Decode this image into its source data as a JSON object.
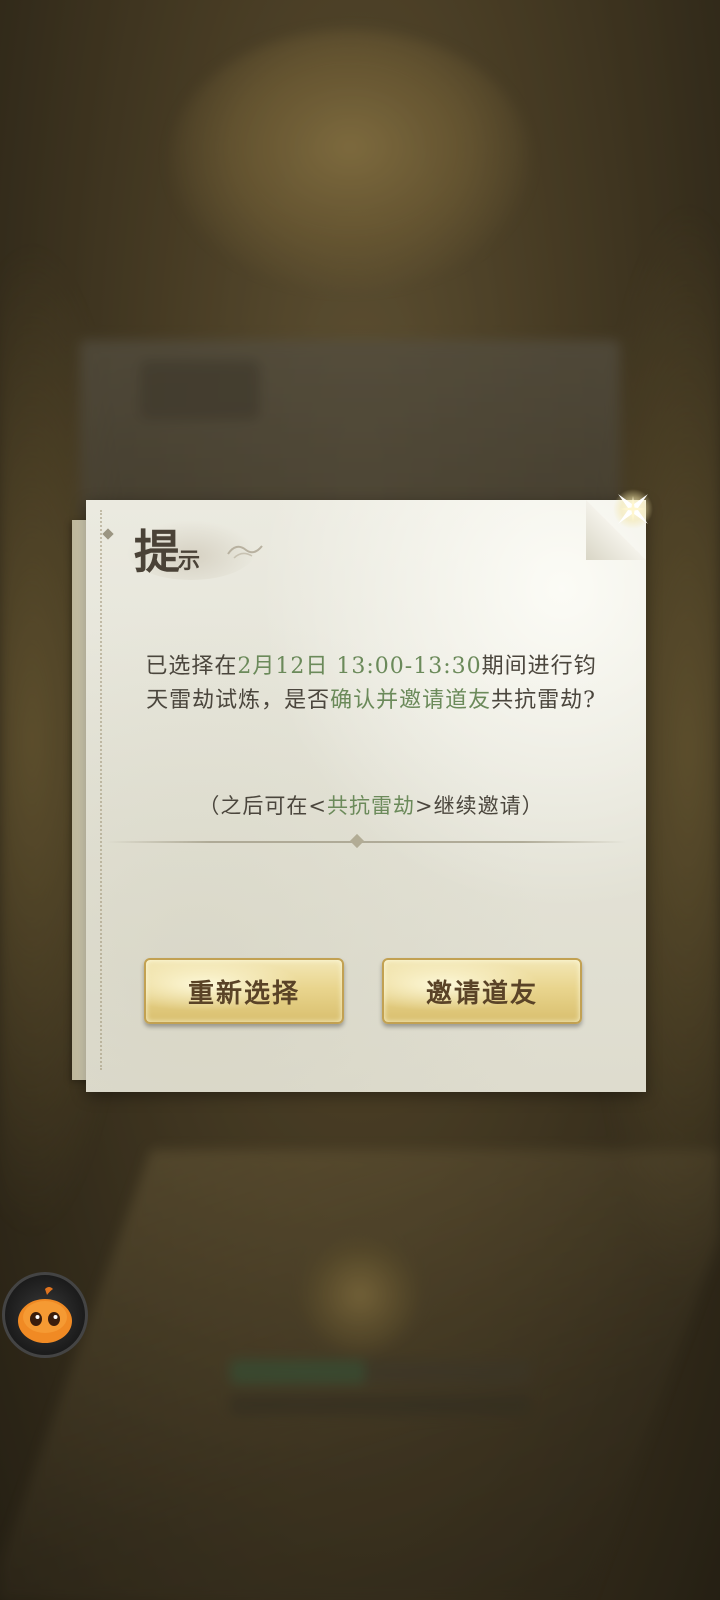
{
  "dialog": {
    "title_main": "提",
    "title_sub": "示",
    "message": {
      "part1": "已选择在",
      "date_time": "2月12日 13:00-13:30",
      "part2": "期间进行钧天雷劫试炼，是否",
      "highlight_action": "确认并邀请道友",
      "part3": "共抗雷劫?"
    },
    "note": {
      "prefix": "（之后可在<",
      "highlight": "共抗雷劫",
      "suffix": ">继续邀请）"
    },
    "buttons": {
      "reselect": "重新选择",
      "invite": "邀请道友"
    }
  },
  "colors": {
    "highlight_text": "#6b8a5a",
    "body_text": "#4b463d",
    "button_gold": "#e9d58e"
  },
  "icons": {
    "close": "sparkle-close-icon",
    "assistant": "orange-mascot-icon"
  }
}
